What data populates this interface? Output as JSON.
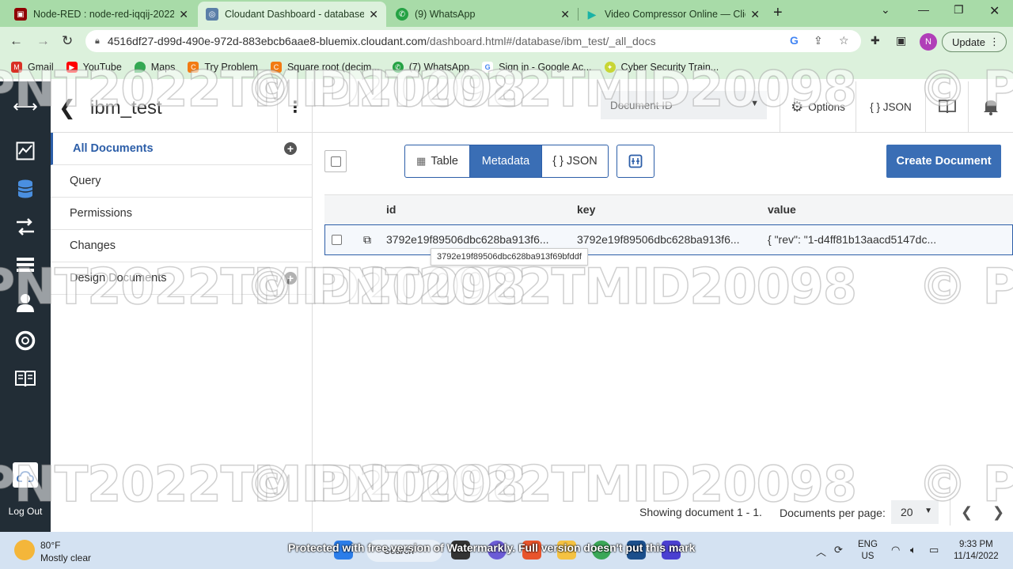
{
  "browser": {
    "tabs": [
      {
        "title": "Node-RED : node-red-iqqij-2022"
      },
      {
        "title": "Cloudant Dashboard - database/"
      },
      {
        "title": "(9) WhatsApp"
      },
      {
        "title": "Video Compressor Online — Clic"
      }
    ],
    "url_host": "4516df27-d99d-490e-972d-883ebcb6aae8-bluemix.cloudant.com",
    "url_path": "/dashboard.html#/database/ibm_test/_all_docs",
    "profile_initial": "N",
    "update_label": "Update",
    "bookmarks": [
      "Gmail",
      "YouTube",
      "Maps",
      "Try Problem",
      "Square root (decim...",
      "(7) WhatsApp",
      "Sign in - Google Ac...",
      "Cyber Security Train..."
    ]
  },
  "app": {
    "db_name": "ibm_test",
    "sidebar": [
      {
        "label": "All Documents"
      },
      {
        "label": "Query"
      },
      {
        "label": "Permissions"
      },
      {
        "label": "Changes"
      },
      {
        "label": "Design Documents"
      }
    ],
    "logout_label": "Log Out",
    "doc_id_placeholder": "Document ID",
    "options_label": "Options",
    "json_label": "{ } JSON",
    "views": [
      "Table",
      "Metadata",
      "{ } JSON"
    ],
    "active_view": "Metadata",
    "create_label": "Create Document",
    "columns": [
      "id",
      "key",
      "value"
    ],
    "rows": [
      {
        "id": "3792e19f89506dbc628ba913f6...",
        "key": "3792e19f89506dbc628ba913f6...",
        "value": "{ \"rev\": \"1-d4ff81b13aacd5147dc..."
      }
    ],
    "tooltip": "3792e19f89506dbc628ba913f69bfddf",
    "showing": "Showing document 1 - 1.",
    "per_page_label": "Documents per page:",
    "per_page": "20",
    "watermark": "© PNT2022TMID20098"
  },
  "taskbar": {
    "temp": "80°F",
    "condition": "Mostly clear",
    "search": "Search",
    "banner": "Protected with free version of Watermarkly. Full version doesn't put this mark",
    "lang1": "ENG",
    "lang2": "US",
    "time": "9:33 PM",
    "date": "11/14/2022"
  },
  "colors": {
    "accent": "#3a6eb5",
    "nav": "#222d36",
    "chrome": "#dcf1dc"
  }
}
